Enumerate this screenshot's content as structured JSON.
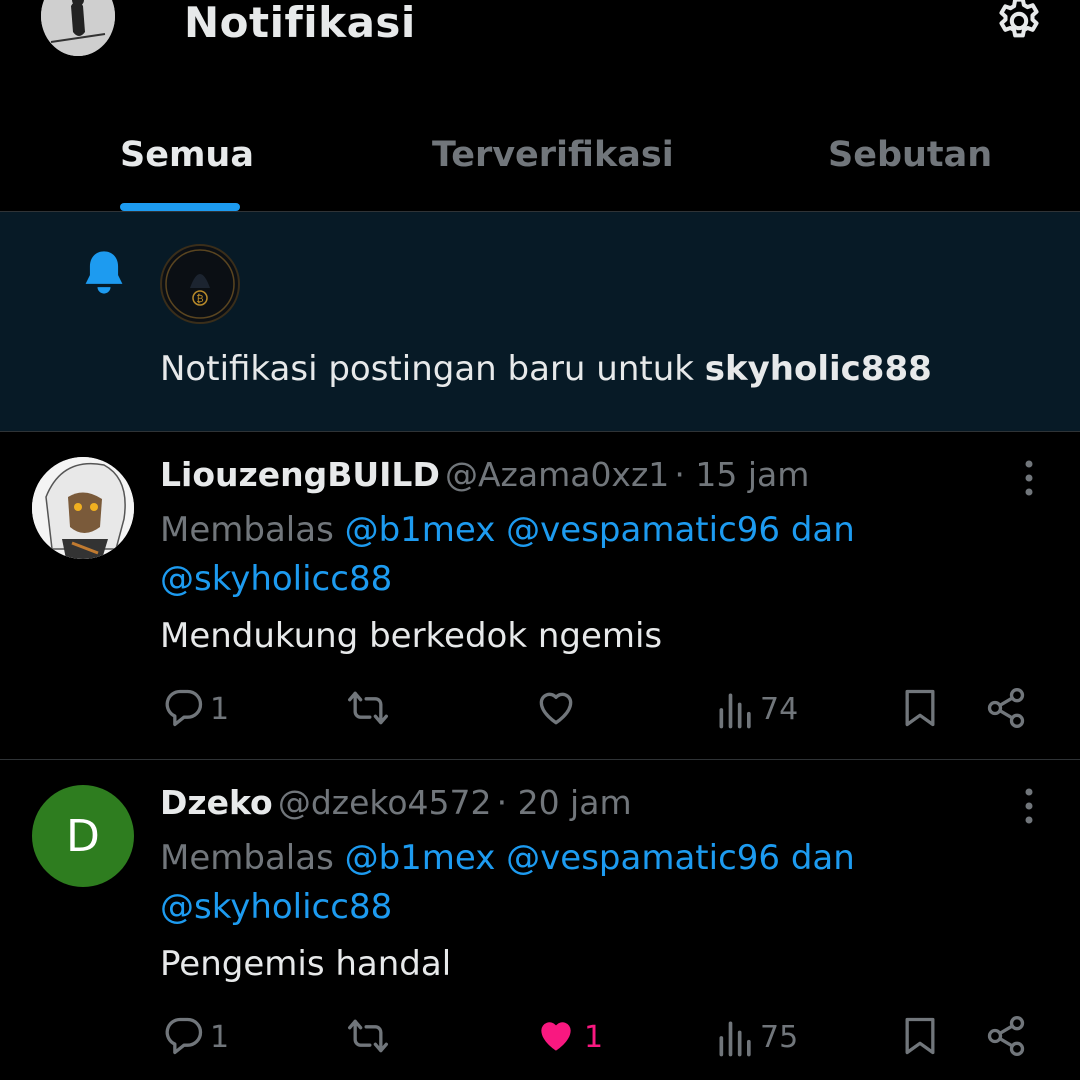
{
  "header": {
    "title": "Notifikasi"
  },
  "tabs": [
    {
      "label": "Semua",
      "active": true
    },
    {
      "label": "Terverifikasi",
      "active": false
    },
    {
      "label": "Sebutan",
      "active": false
    }
  ],
  "alert": {
    "text": "Notifikasi postingan baru untuk ",
    "username": "skyholic888"
  },
  "posts": [
    {
      "display_name": "LiouzengBUILD",
      "handle": "@Azama0xz1",
      "time": "· 15 jam",
      "reply_prefix": "Membalas ",
      "reply_mentions": "@b1mex @vespamatic96 dan",
      "reply_mentions_2": "@skyholicc88",
      "text": "Mendukung berkedok ngemis",
      "replies": "1",
      "retweets": "",
      "likes": "",
      "liked": false,
      "views": "74"
    },
    {
      "display_name": "Dzeko",
      "handle": "@dzeko4572",
      "time": "· 20 jam",
      "avatar_letter": "D",
      "reply_prefix": "Membalas ",
      "reply_mentions": "@b1mex @vespamatic96 dan",
      "reply_mentions_2": "@skyholicc88",
      "text": "Pengemis handal",
      "replies": "1",
      "retweets": "",
      "likes": "1",
      "liked": true,
      "views": "75"
    }
  ],
  "colors": {
    "accent": "#1d9bf0",
    "like": "#f91880",
    "muted": "#71767b",
    "alert_bg": "#071a26"
  },
  "icons": [
    "gear-icon",
    "bell-icon",
    "reply-icon",
    "retweet-icon",
    "heart-icon",
    "views-icon",
    "bookmark-icon",
    "share-icon",
    "more-icon"
  ]
}
